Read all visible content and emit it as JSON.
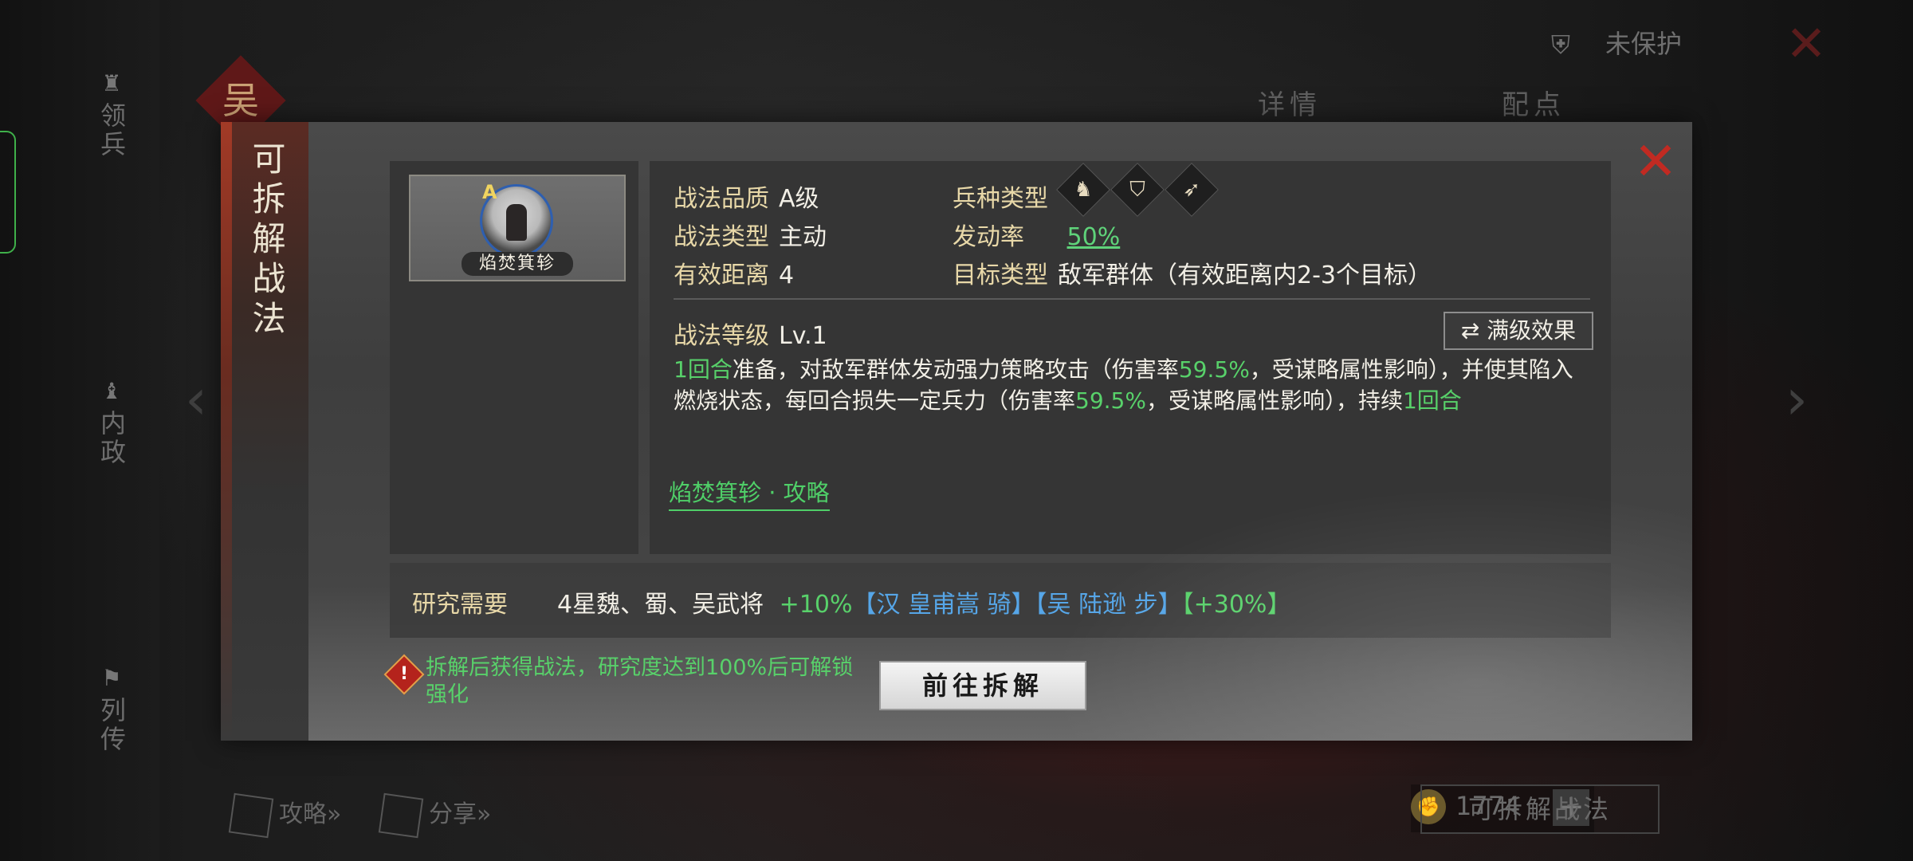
{
  "background": {
    "side_tabs": [
      {
        "label": "领兵",
        "icon": "helmet-icon"
      },
      {
        "label": "内政",
        "icon": "scroll-icon"
      },
      {
        "label": "列传",
        "icon": "flag-icon"
      }
    ],
    "faction_char": "吴",
    "top_right": {
      "protect_label": "未保护"
    },
    "top_tabs": [
      "详情",
      "配点"
    ],
    "bottom": {
      "guide_label": "攻略»",
      "share_label": "分享»",
      "merit_value": "1774",
      "plus_label": "+",
      "disassemble_btn": "可拆解战法"
    }
  },
  "modal": {
    "title": "可拆解战法",
    "close_symbol": "✕",
    "card": {
      "grade": "A",
      "name": "焰焚箕轸"
    },
    "info": {
      "quality_label": "战法品质",
      "quality_value": "A级",
      "type_label": "战法类型",
      "type_value": "主动",
      "range_label": "有效距离",
      "range_value": "4",
      "troop_label": "兵种类型",
      "troop_icons": [
        "cavalry-icon",
        "shield-icon",
        "bow-icon"
      ],
      "rate_label": "发动率",
      "rate_value": "50%",
      "target_label": "目标类型",
      "target_value": "敌军群体（有效距离内2-3个目标）",
      "level_label": "战法等级",
      "level_value": "Lv.1",
      "max_effect_btn": "满级效果",
      "desc": {
        "p1_green": "1回合",
        "p1": "准备，对敌军群体发动强力策略攻击（伤害率",
        "p2_green": "59.5%",
        "p2": "，受谋略属性影响），并使其陷入燃烧状态，每回合损失一定兵力（伤害率",
        "p3_green": "59.5%",
        "p3": "，受谋略属性影响），持续",
        "p4_green": "1回合"
      },
      "guide_link": "焰焚箕轸 · 攻略"
    },
    "research": {
      "label": "研究需要",
      "req": "4星魏、蜀、吴武将",
      "bonus1": "+10%",
      "bracket1_open": "【",
      "hero1": "汉 皇甫嵩 骑",
      "bracket1_close": "】",
      "bracket2_open": "【",
      "hero2": "吴 陆逊 步",
      "bracket2_close": "】",
      "bonus2": "【+30%】"
    },
    "warning": "拆解后获得战法，研究度达到100%后可解锁强化",
    "go_button": "前往拆解"
  },
  "colors": {
    "accent_green": "#58d16a",
    "accent_blue": "#56a6e8",
    "close_red": "#c12a22",
    "label_gold": "#e8d8a8"
  }
}
